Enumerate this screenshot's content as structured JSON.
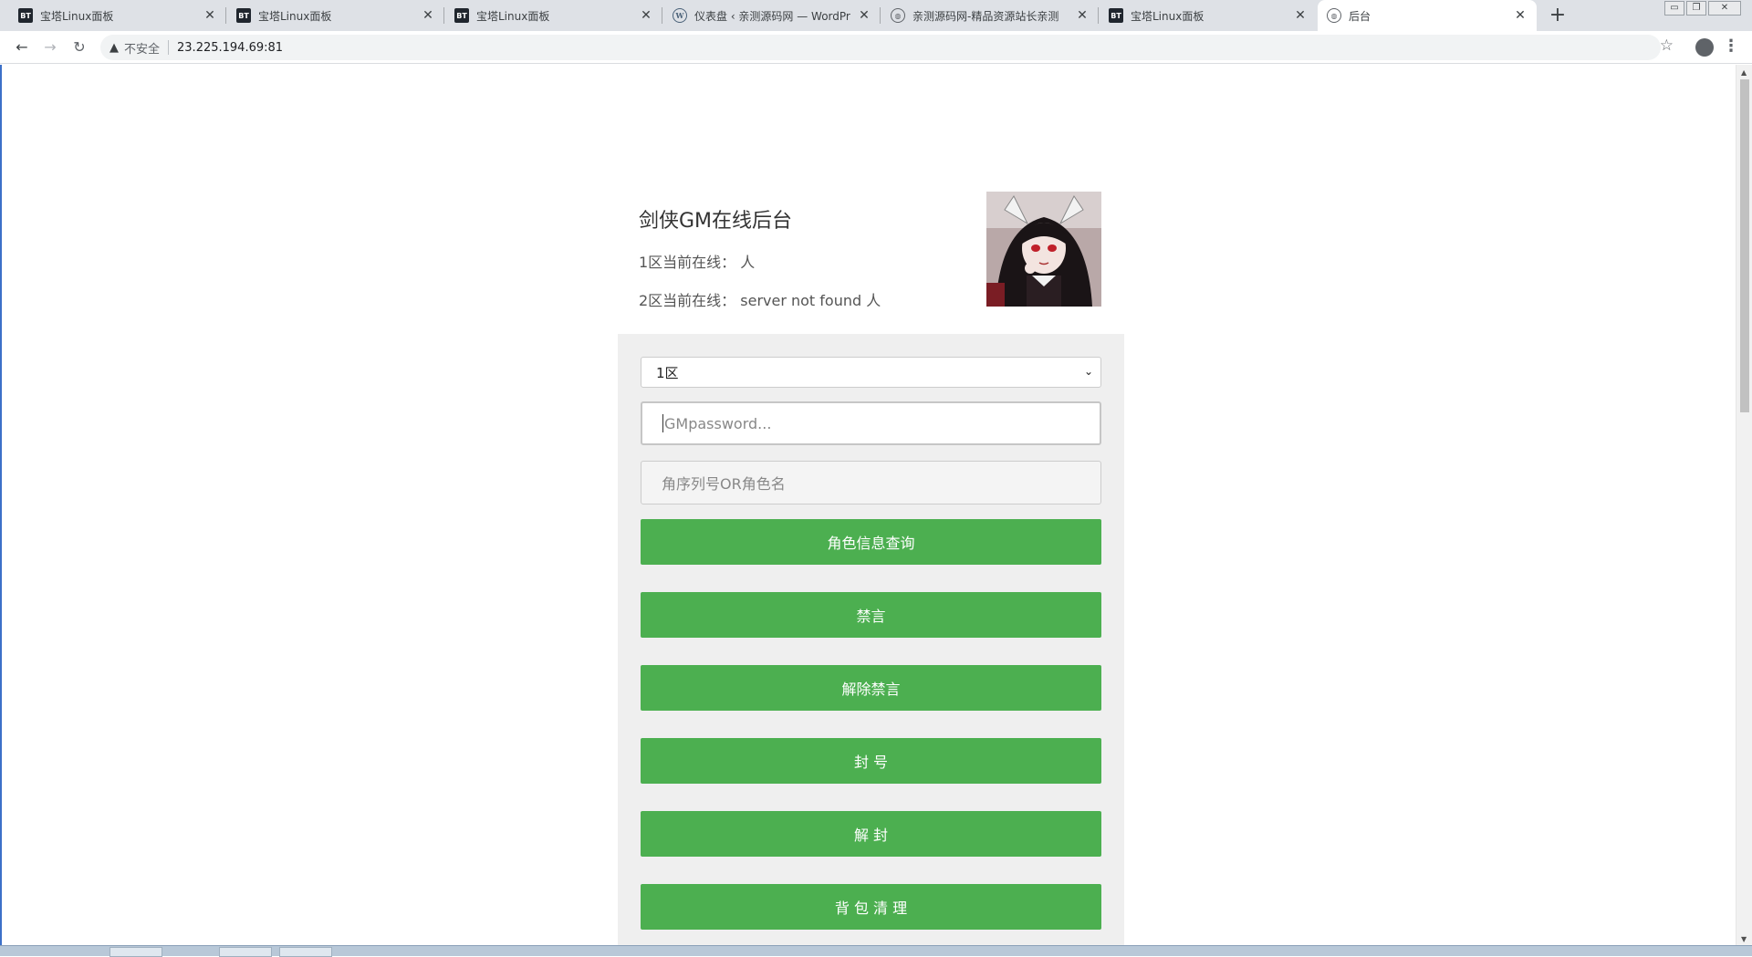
{
  "browser": {
    "tabs": [
      {
        "title": "宝塔Linux面板",
        "icon": "bt-icon"
      },
      {
        "title": "宝塔Linux面板",
        "icon": "bt-icon"
      },
      {
        "title": "宝塔Linux面板",
        "icon": "bt-icon"
      },
      {
        "title": "仪表盘 ‹ 亲测源码网 — WordPr",
        "icon": "wordpress-icon"
      },
      {
        "title": "亲测源码网-精品资源站长亲测",
        "icon": "globe-icon"
      },
      {
        "title": "宝塔Linux面板",
        "icon": "bt-icon"
      },
      {
        "title": "后台",
        "icon": "globe-icon",
        "active": true
      }
    ],
    "security_label": "不安全",
    "url": "23.225.194.69:81"
  },
  "header": {
    "title": "剑侠GM在线后台",
    "zone1_online": "1区当前在线： 人",
    "zone2_online": "2区当前在线： server not found 人"
  },
  "form": {
    "zone_selected": "1区",
    "password_placeholder": "GMpassword...",
    "role_placeholder": "角序列号OR角色名"
  },
  "buttons": {
    "query": "角色信息查询",
    "mute": "禁言",
    "unmute": "解除禁言",
    "ban": "封 号",
    "unban": "解 封",
    "clear_bag": "背 包 清 理"
  },
  "colors": {
    "button_green": "#4caf50",
    "panel_bg": "#efefef"
  }
}
